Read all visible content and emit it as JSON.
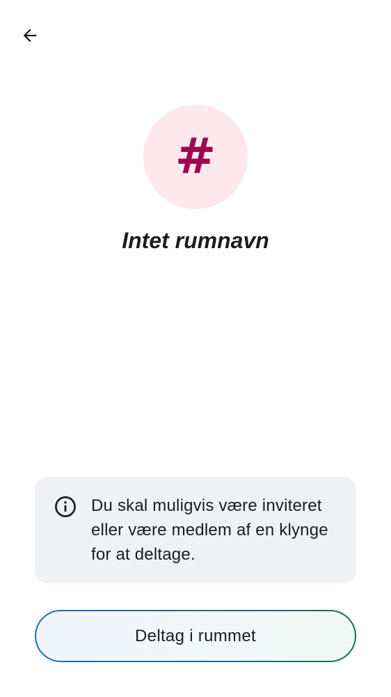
{
  "toolbar": {
    "back_icon": "arrow-left-icon"
  },
  "room": {
    "avatar_glyph": "#",
    "avatar_bg_color": "#fde8ee",
    "avatar_glyph_color": "#9b0a4f",
    "title": "Intet rumnavn"
  },
  "notice": {
    "icon": "info-icon",
    "text": "Du skal muligvis være inviteret eller være medlem af en klynge for at deltage."
  },
  "actions": {
    "join_label": "Deltag i rummet"
  }
}
